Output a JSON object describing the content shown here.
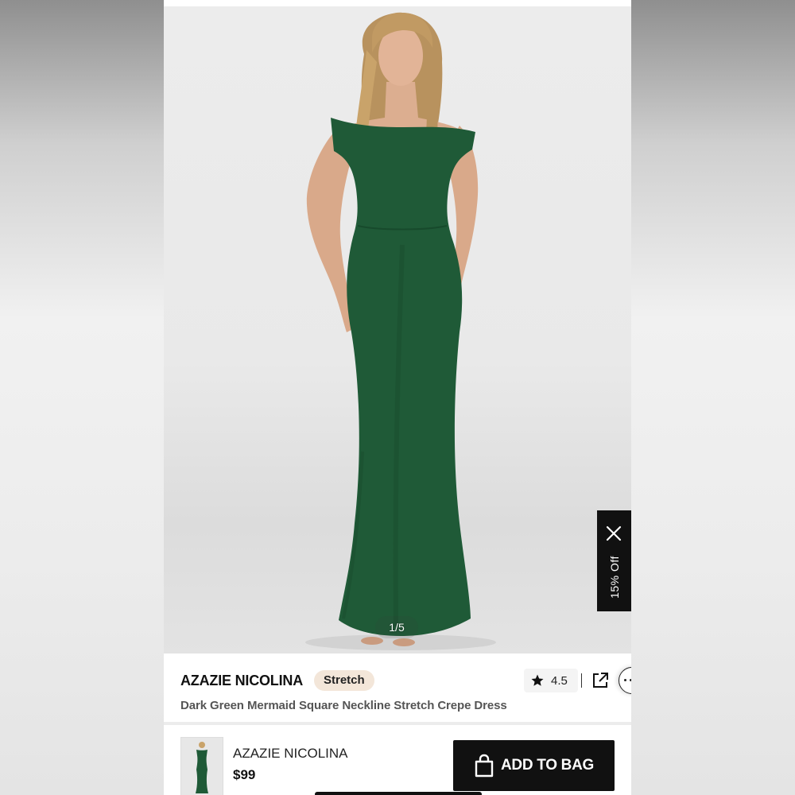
{
  "product_image": {
    "counter": "1/5"
  },
  "promo": {
    "discount_label": "15% Off"
  },
  "product": {
    "brand": "AZAZIE NICOLINA",
    "badge": "Stretch",
    "rating": "4.5",
    "title": "Dark Green Mermaid Square Neckline Stretch Crepe Dress"
  },
  "bottom_bar": {
    "brand": "AZAZIE NICOLINA",
    "price": "$99",
    "add_to_bag_label": "ADD TO BAG"
  },
  "icons": [
    "close-icon",
    "star-icon",
    "share-icon",
    "more-icon",
    "shopping-bag-icon"
  ],
  "colors": {
    "dress_green": "#1f5a37",
    "badge_bg": "#f3e6d9",
    "button_bg": "#111111",
    "promo_tab_bg": "#111111"
  }
}
